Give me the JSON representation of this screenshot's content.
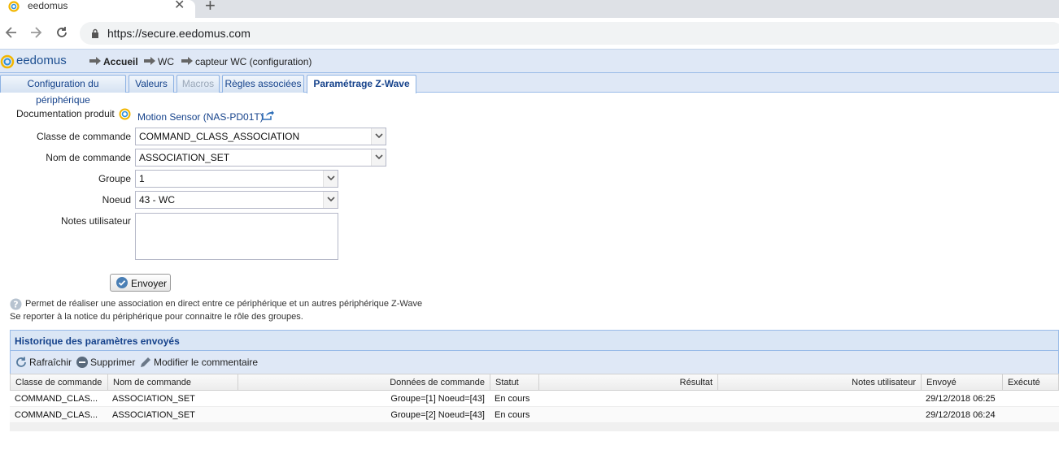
{
  "browser": {
    "tab_title": "eedomus",
    "tab_close": "✕",
    "new_tab": "+",
    "url": "https://secure.eedomus.com"
  },
  "app": {
    "logo": "eedomus",
    "breadcrumb": [
      "Accueil",
      "WC",
      "capteur WC (configuration)"
    ]
  },
  "tabs": [
    {
      "label": "Configuration du périphérique",
      "state": "normal"
    },
    {
      "label": "Valeurs",
      "state": "normal"
    },
    {
      "label": "Macros",
      "state": "disabled"
    },
    {
      "label": "Règles associées",
      "state": "normal"
    },
    {
      "label": "Paramétrage Z-Wave",
      "state": "active"
    }
  ],
  "form": {
    "doc_label": "Documentation produit",
    "doc_link": "Motion Sensor (NAS-PD01T)",
    "classe_label": "Classe de commande",
    "classe_value": "COMMAND_CLASS_ASSOCIATION",
    "nom_label": "Nom de commande",
    "nom_value": "ASSOCIATION_SET",
    "groupe_label": "Groupe",
    "groupe_value": "1",
    "noeud_label": "Noeud",
    "noeud_value": "43 - WC",
    "notes_label": "Notes utilisateur",
    "notes_value": "",
    "submit_label": "Envoyer"
  },
  "help": {
    "line1": "Permet de réaliser une association en direct entre ce périphérique et un autres périphérique Z-Wave",
    "line2": "Se reporter à la notice du périphérique pour connaitre le rôle des groupes."
  },
  "history": {
    "title": "Historique des paramètres envoyés",
    "toolbar": {
      "refresh": "Rafraîchir",
      "delete": "Supprimer",
      "edit_comment": "Modifier le commentaire"
    },
    "columns": [
      "Classe de commande",
      "Nom de commande",
      "Données de commande",
      "Statut",
      "Résultat",
      "Notes utilisateur",
      "Envoyé",
      "Exécuté"
    ],
    "rows": [
      {
        "classe": "COMMAND_CLAS...",
        "nom": "ASSOCIATION_SET",
        "donnees": "Groupe=[1] Noeud=[43]",
        "statut": "En cours",
        "resultat": "",
        "notes": "",
        "envoye": "29/12/2018 06:25",
        "execute": ""
      },
      {
        "classe": "COMMAND_CLAS...",
        "nom": "ASSOCIATION_SET",
        "donnees": "Groupe=[2] Noeud=[43]",
        "statut": "En cours",
        "resultat": "",
        "notes": "",
        "envoye": "29/12/2018 06:24",
        "execute": ""
      }
    ]
  },
  "colors": {
    "accent": "#15428b",
    "header_bg": "#dfe8f6",
    "border": "#99bbe8"
  }
}
